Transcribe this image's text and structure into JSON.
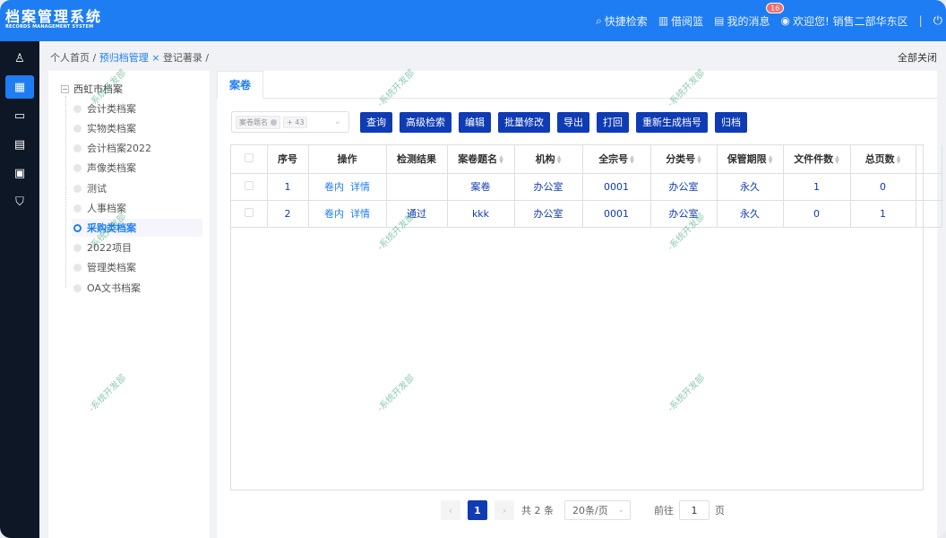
{
  "app": {
    "title_cn": "档案管理系统",
    "title_en": "RECORDS MANAGEMENT SYSTEM"
  },
  "header": {
    "quick_search": "快捷检索",
    "borrow_basket": "借阅篮",
    "my_messages": "我的消息",
    "message_count": "16",
    "welcome": "欢迎您! 销售二部华东区",
    "separator": "|"
  },
  "breadcrumb": {
    "home": "个人首页 /",
    "current": "预归档管理",
    "close": "×",
    "tail": "登记著录 /",
    "close_all": "全部关闭"
  },
  "tree": {
    "root": "西虹市档案",
    "items": [
      "会计类档案",
      "实物类档案",
      "会计档案2022",
      "声像类档案",
      "测试",
      "人事档案",
      "采购类档案",
      "2022项目",
      "管理类档案",
      "OA文书档案"
    ],
    "selected_index": 6
  },
  "tabs": [
    "案卷"
  ],
  "toolbar": {
    "select_tag": "案卷题名",
    "select_more": "+ 43",
    "buttons": [
      "查询",
      "高级检索",
      "编辑",
      "批量修改",
      "导出",
      "打回",
      "重新生成档号",
      "归档"
    ]
  },
  "table": {
    "headers": [
      "序号",
      "操作",
      "检测结果",
      "案卷题名",
      "机构",
      "全宗号",
      "分类号",
      "保管期限",
      "文件件数",
      "总页数"
    ],
    "rows": [
      {
        "no": "1",
        "op1": "卷内",
        "op2": "详情",
        "check": "",
        "title": "案卷",
        "org": "办公室",
        "fonds": "0001",
        "category": "办公室",
        "period": "永久",
        "files": "1",
        "pages": "0"
      },
      {
        "no": "2",
        "op1": "卷内",
        "op2": "详情",
        "check": "通过",
        "title": "kkk",
        "org": "办公室",
        "fonds": "0001",
        "category": "办公室",
        "period": "永久",
        "files": "0",
        "pages": "1"
      }
    ]
  },
  "pagination": {
    "current_page": "1",
    "total": "共 2 条",
    "page_size": "20条/页",
    "goto_prefix": "前往",
    "goto_value": "1",
    "goto_suffix": "页"
  },
  "watermark": "-系统开发部",
  "colors": {
    "primary": "#1e7df2",
    "button": "#0f3bb4",
    "rail": "#0e1726",
    "badge": "#f56c6c"
  }
}
